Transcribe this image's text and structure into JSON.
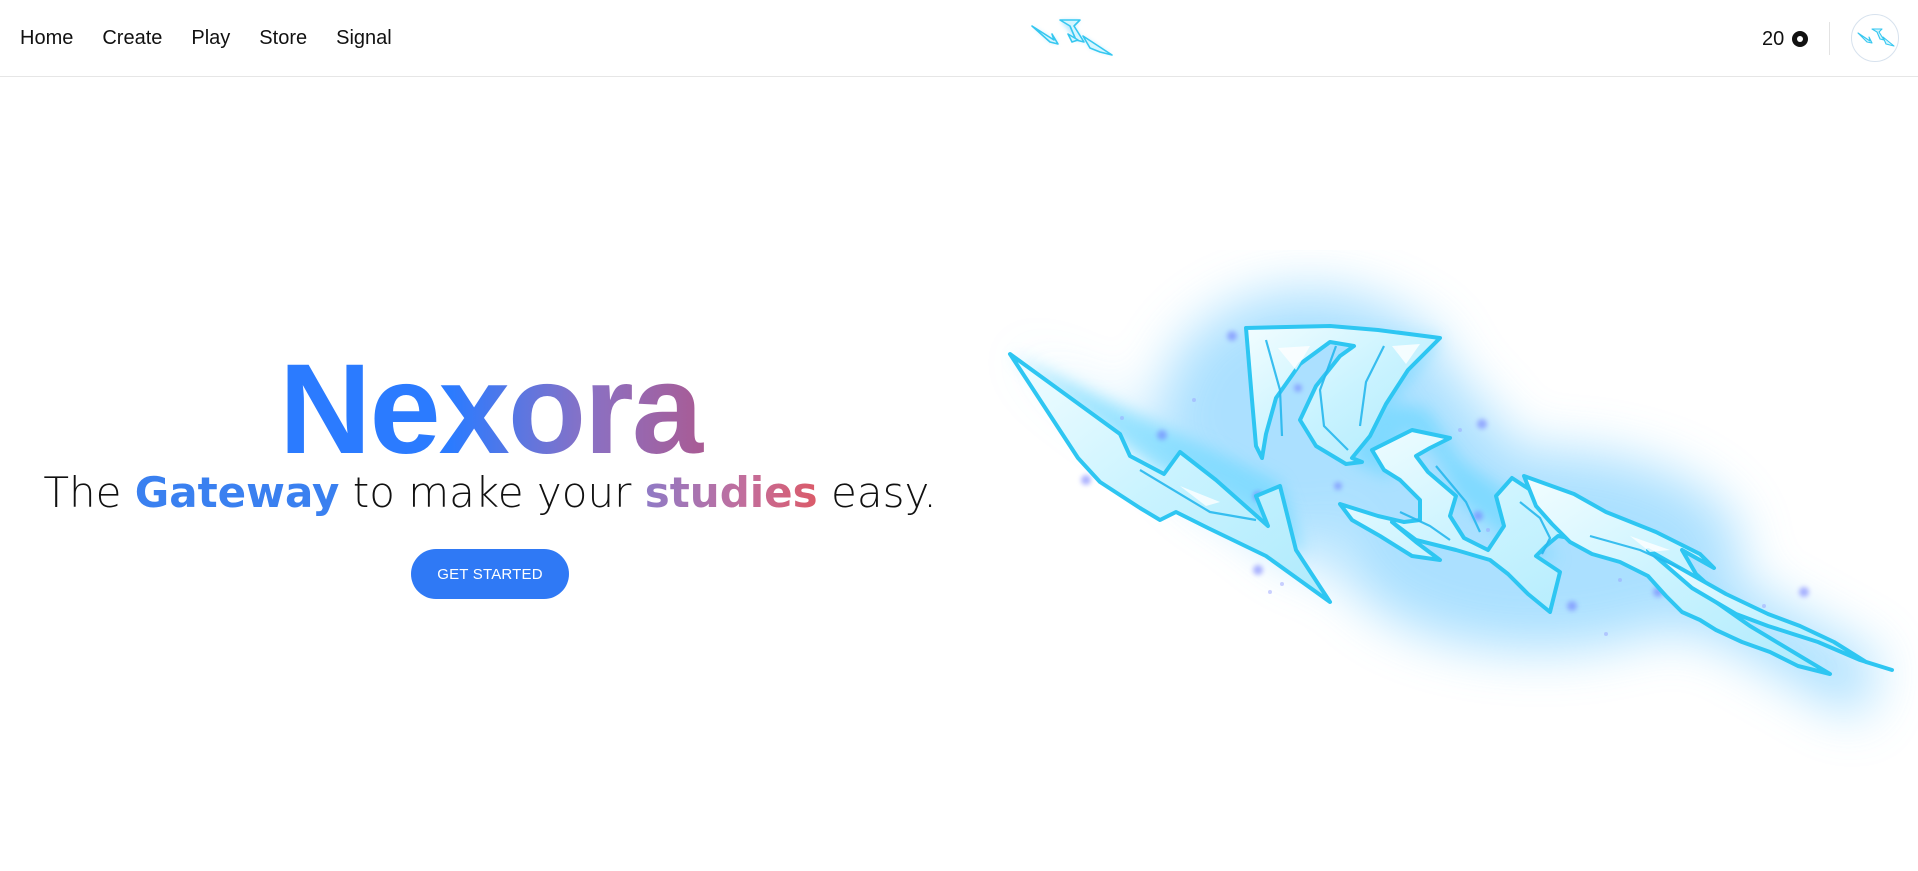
{
  "nav": {
    "links": [
      "Home",
      "Create",
      "Play",
      "Store",
      "Signal"
    ],
    "coins": "20",
    "coin_icon": "coin-icon",
    "logo_icon": "lightning-logo-icon",
    "avatar_icon": "avatar-logo-icon"
  },
  "hero": {
    "title_letters": [
      "N",
      "e",
      "x",
      "o",
      "r",
      "a"
    ],
    "tagline": {
      "part1": "The ",
      "highlight1": "Gateway",
      "part2": " to make your ",
      "highlight2": "studies",
      "part3": " easy."
    },
    "cta_label": "GET STARTED",
    "art_icon": "lightning-bolt-illustration"
  },
  "colors": {
    "accent_blue": "#2f79f5",
    "accent_red": "#d7333f",
    "lightning_cyan": "#3fd0f5"
  }
}
